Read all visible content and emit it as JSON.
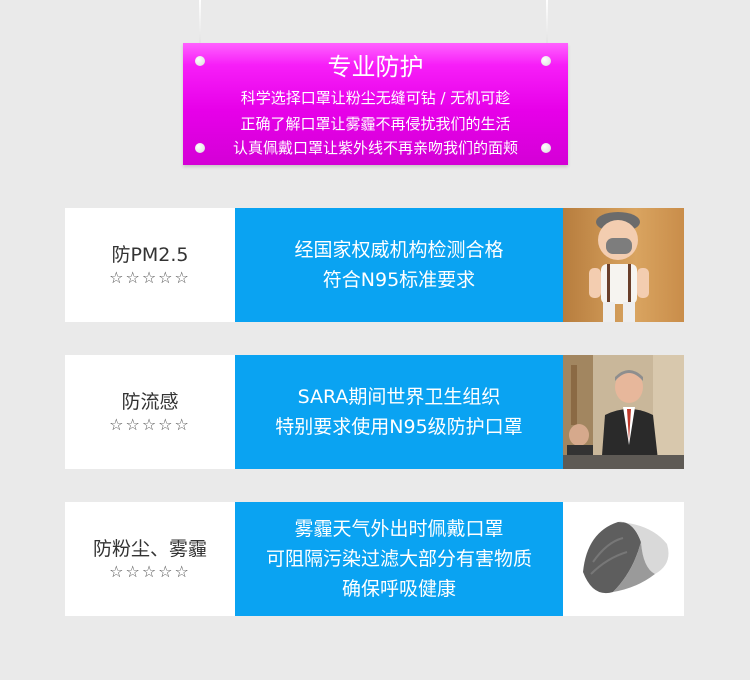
{
  "banner": {
    "title": "专业防护",
    "lines": [
      "科学选择口罩让粉尘无缝可钻 / 无机可趁",
      "正确了解口罩让雾霾不再侵扰我们的生活",
      "认真佩戴口罩让紫外线不再亲吻我们的面颊"
    ]
  },
  "rows": [
    {
      "label": "防PM2.5",
      "stars": "☆☆☆☆☆",
      "desc": [
        "经国家权威机构检测合格",
        "符合N95标准要求"
      ],
      "image": "child-wearing-mask-photo"
    },
    {
      "label": "防流感",
      "stars": "☆☆☆☆☆",
      "desc": [
        "SARA期间世界卫生组织",
        "特别要求使用N95级防护口罩"
      ],
      "image": "conference-speaker-photo"
    },
    {
      "label": "防粉尘、雾霾",
      "stars": "☆☆☆☆☆",
      "desc": [
        "雾霾天气外出时佩戴口罩",
        "可阻隔污染过滤大部分有害物质",
        "确保呼吸健康"
      ],
      "image": "gray-mask-product-photo"
    }
  ],
  "colors": {
    "background": "#eaeaea",
    "banner": "#e700e9",
    "desc_panel": "#0aa3f2"
  }
}
